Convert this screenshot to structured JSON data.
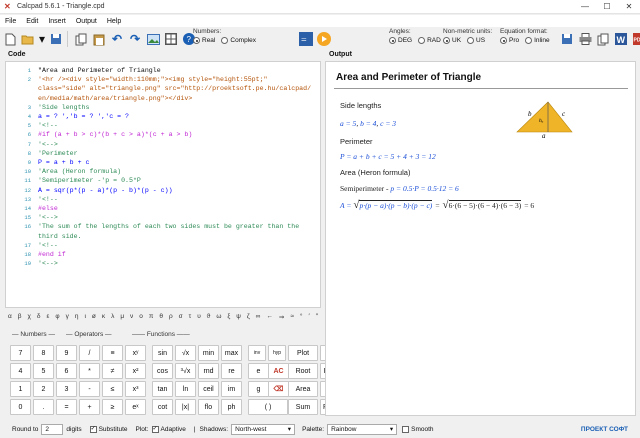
{
  "window": {
    "title": "Calcpad 5.6.1 - Triangle.cpd",
    "minimize": "—",
    "maximize": "☐",
    "close": "✕"
  },
  "menu": [
    "File",
    "Edit",
    "Insert",
    "Output",
    "Help"
  ],
  "numbers": {
    "label": "Numbers:",
    "real": "Real",
    "complex": "Complex",
    "selected": "Real"
  },
  "angles": {
    "label": "Angles:",
    "deg": "DEG",
    "rad": "RAD",
    "selected": "DEG"
  },
  "units": {
    "label": "Non-metric units:",
    "uk": "UK",
    "us": "US",
    "selected": "UK"
  },
  "eqformat": {
    "label": "Equation format:",
    "pro": "Pro",
    "inline": "Inline",
    "selected": "Pro"
  },
  "panes": {
    "code": "Code",
    "output": "Output"
  },
  "code_lines": [
    {
      "n": "1",
      "t": "\"Area and Perimeter of Triangle",
      "cls": "c-str"
    },
    {
      "n": "2",
      "t": "'<hr /><div style=\"width:110mm;\"><img style=\"height:55pt;\"",
      "cls": "c-html"
    },
    {
      "n": "",
      "t": "class=\"side\" alt=\"triangle.png\" src=\"http://proektsoft.pe.hu/calcpad/",
      "cls": "c-html"
    },
    {
      "n": "",
      "t": "en/media/math/area/triangle.png\"></div>",
      "cls": "c-html"
    },
    {
      "n": "3",
      "t": "'Side lengths",
      "cls": "c-com"
    },
    {
      "n": "4",
      "t": "a = ? ','b = ? ','c = ?",
      "cls": "c-var"
    },
    {
      "n": "5",
      "t": "'<!--",
      "cls": "c-com"
    },
    {
      "n": "6",
      "t": "#if (a + b > c)*(b + c > a)*(c + a > b)",
      "cls": "c-kw"
    },
    {
      "n": "7",
      "t": "    '<-->",
      "cls": "c-com"
    },
    {
      "n": "8",
      "t": "    'Perimeter",
      "cls": "c-com"
    },
    {
      "n": "9",
      "t": "    P = a + b + c",
      "cls": "c-var"
    },
    {
      "n": "10",
      "t": "    'Area (Heron formula)",
      "cls": "c-com"
    },
    {
      "n": "11",
      "t": "    'Semiperimeter -'p = 0.5*P",
      "cls": "c-com"
    },
    {
      "n": "12",
      "t": "    A = sqr(p*(p - a)*(p - b)*(p - c))",
      "cls": "c-var"
    },
    {
      "n": "13",
      "t": "    '<!--",
      "cls": "c-com"
    },
    {
      "n": "14",
      "t": "#else",
      "cls": "c-kw"
    },
    {
      "n": "15",
      "t": "    '<-->",
      "cls": "c-com"
    },
    {
      "n": "16",
      "t": "    'The sum of the lengths of each two sides must be greater than the",
      "cls": "c-com"
    },
    {
      "n": "",
      "t": "third side.",
      "cls": "c-com"
    },
    {
      "n": "17",
      "t": "    '<!--",
      "cls": "c-com"
    },
    {
      "n": "18",
      "t": "#end if",
      "cls": "c-kw"
    },
    {
      "n": "19",
      "t": "'<-->",
      "cls": "c-com"
    }
  ],
  "greek": [
    "α",
    "β",
    "χ",
    "δ",
    "ε",
    "φ",
    "γ",
    "η",
    "ι",
    "ø",
    "κ",
    "λ",
    "μ",
    "ν",
    "ο",
    "π",
    "θ",
    "ρ",
    "σ",
    "τ",
    "υ",
    "ϑ",
    "ω",
    "ξ",
    "ψ",
    "ζ",
    "∞",
    "←",
    "⇒",
    "≈",
    "°",
    "′",
    "″"
  ],
  "keypad_heads": {
    "numbers": "Numbers",
    "operators": "Operators",
    "functions": "Functions"
  },
  "keys": {
    "r1": [
      "7",
      "8",
      "9",
      "/",
      "≡",
      "xʸ",
      "sin",
      "√x",
      "min",
      "max",
      "inv",
      "hyp",
      "Plot",
      "Map"
    ],
    "r2": [
      "4",
      "5",
      "6",
      "*",
      "≠",
      "x²",
      "cos",
      "³√x",
      "rnd",
      "re",
      "e",
      "AC",
      "Root",
      "Repeat"
    ],
    "r3": [
      "1",
      "2",
      "3",
      "-",
      "≤",
      "x³",
      "tan",
      "ln",
      "ceil",
      "im",
      "g",
      "⌫",
      "Area",
      "Slope"
    ],
    "r4": [
      "0",
      ".",
      "=",
      "+",
      "≥",
      "eˣ",
      "cot",
      "|x|",
      "flo",
      "ph",
      "( )",
      "Sum",
      "Product"
    ]
  },
  "output": {
    "title": "Area and Perimeter of Triangle",
    "side_lengths": "Side lengths",
    "a_eq": "a = 5",
    "b_eq": "b = 4",
    "c_eq": "c = 3",
    "perimeter_head": "Perimeter",
    "perimeter_eq": "P = a + b + c = 5 + 4 + 3 = 12",
    "area_head": "Area (Heron formula)",
    "semi_label": "Semiperimeter -",
    "semi_eq": "p = 0.5·P = 0.5·12 = 6",
    "area_eq_lhs": "A =",
    "area_eq_rad1": "p·(p − a)·(p − b)·(p − c)",
    "area_eq_mid": "=",
    "area_eq_rad2": "6·(6 − 5)·(6 − 4)·(6 − 3)",
    "area_eq_result": "= 6",
    "tri_a": "a",
    "tri_b": "b",
    "tri_c": "c",
    "tri_h": "hₐ"
  },
  "status": {
    "round_label": "Round to",
    "round_value": "2",
    "digits": "digits",
    "substitute": "Substitute",
    "plot": "Plot:",
    "adaptive": "Adaptive",
    "shadows": "Shadows:",
    "shadows_value": "North-west",
    "palette": "Palette:",
    "palette_value": "Rainbow",
    "smooth": "Smooth",
    "brand": "ПРОЕКТ СОФТ"
  },
  "colors": {
    "accent": "#1a4ed8",
    "brand": "#1a5fb4",
    "triangle": "#f0b429",
    "code_keyword": "#c026d3",
    "code_comment": "#2e8b57"
  }
}
